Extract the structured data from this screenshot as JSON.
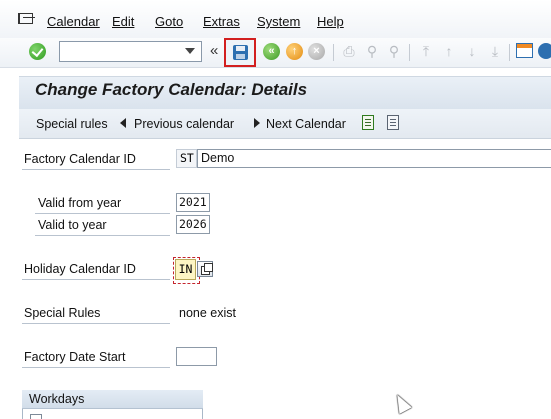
{
  "menu": {
    "items": [
      {
        "label": "Calendar"
      },
      {
        "label": "Edit"
      },
      {
        "label": "Goto"
      },
      {
        "label": "Extras"
      },
      {
        "label": "System"
      },
      {
        "label": "Help"
      }
    ]
  },
  "toolbar": {
    "command_field_value": "",
    "collapse_symbol": "«",
    "icons": [
      "enter-icon",
      "save-icon",
      "back-icon",
      "exit-icon",
      "cancel-icon",
      "print-icon",
      "find-icon",
      "find-next-icon",
      "first-page-icon",
      "previous-page-icon",
      "next-page-icon",
      "last-page-icon",
      "layout-icon",
      "help-icon"
    ]
  },
  "title": "Change Factory Calendar: Details",
  "app_toolbar": {
    "special_rules": "Special rules",
    "previous_calendar": "Previous calendar",
    "next_calendar": "Next Calendar"
  },
  "form": {
    "factory_calendar_id_label": "Factory Calendar ID",
    "factory_calendar_id_value": "ST",
    "factory_calendar_desc": "Demo",
    "valid_from_label": "Valid from year",
    "valid_from_value": "2021",
    "valid_to_label": "Valid to year",
    "valid_to_value": "2026",
    "holiday_calendar_label": "Holiday Calendar ID",
    "holiday_calendar_value": "IN",
    "special_rules_label": "Special Rules",
    "special_rules_value": "none exist",
    "factory_date_start_label": "Factory Date Start",
    "factory_date_start_value": ""
  },
  "workdays": {
    "title": "Workdays"
  },
  "colors": {
    "save_highlight": "#d21f1f",
    "title_bar": "#dae3ed",
    "holiday_field": "#fdf6c4"
  }
}
